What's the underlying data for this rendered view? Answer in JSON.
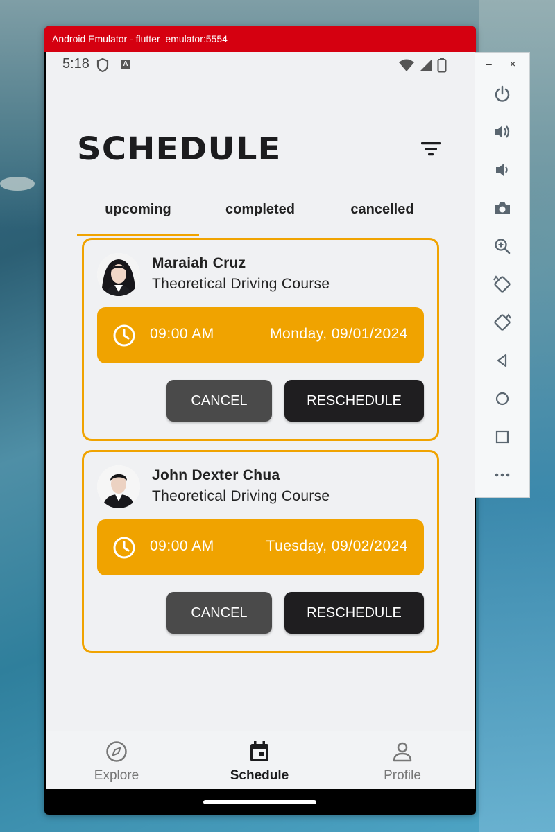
{
  "window": {
    "title": "Android Emulator - flutter_emulator:5554"
  },
  "status_bar": {
    "time": "5:18"
  },
  "page": {
    "title": "SCHEDULE"
  },
  "tabs": [
    {
      "label": "upcoming",
      "active": true
    },
    {
      "label": "completed",
      "active": false
    },
    {
      "label": "cancelled",
      "active": false
    }
  ],
  "appointments": [
    {
      "name": "Maraiah Cruz",
      "course": "Theoretical Driving Course",
      "time": "09:00 AM",
      "date": "Monday, 09/01/2024",
      "cancel_label": "CANCEL",
      "reschedule_label": "RESCHEDULE"
    },
    {
      "name": "John Dexter Chua",
      "course": "Theoretical Driving Course",
      "time": "09:00 AM",
      "date": "Tuesday, 09/02/2024",
      "cancel_label": "CANCEL",
      "reschedule_label": "RESCHEDULE"
    }
  ],
  "bottom_nav": [
    {
      "label": "Explore",
      "icon": "compass-icon",
      "active": false
    },
    {
      "label": "Schedule",
      "icon": "calendar-icon",
      "active": true
    },
    {
      "label": "Profile",
      "icon": "person-icon",
      "active": false
    }
  ],
  "emulator_controls": {
    "minimize": "–",
    "close": "×",
    "buttons": [
      "power-icon",
      "volume-up-icon",
      "volume-down-icon",
      "camera-icon",
      "zoom-icon",
      "rotate-left-icon",
      "rotate-right-icon",
      "back-icon",
      "home-icon",
      "overview-icon",
      "more-icon"
    ]
  },
  "colors": {
    "accent": "#f0a300",
    "titlebar": "#d50010",
    "dark_button": "#1f1e20",
    "grey_button": "#4a4a4a"
  }
}
